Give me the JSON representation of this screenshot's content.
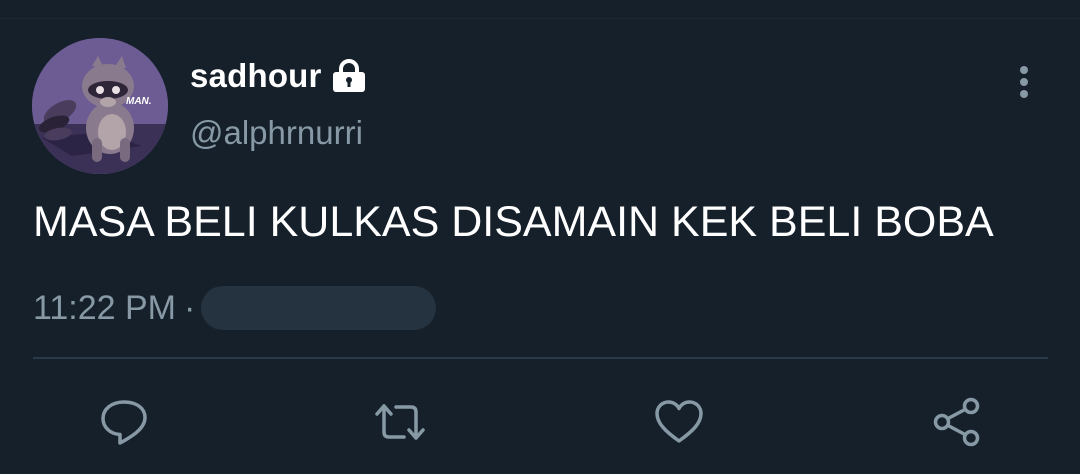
{
  "tweet": {
    "display_name": "sadhour",
    "handle": "@alphrnurri",
    "text": "MASA BELI KULKAS DISAMAIN KEK BELI BOBA",
    "time": "11:22 PM",
    "separator": "·",
    "avatar_caption": "MAN."
  },
  "icons": {
    "lock": "lock-icon",
    "more": "more-vertical-icon",
    "reply": "reply-bubble-icon",
    "retweet": "retweet-icon",
    "like": "heart-icon",
    "share": "share-icon"
  },
  "colors": {
    "background": "#15202b",
    "secondary_text": "#8899a6",
    "divider": "#2b3a48",
    "redacted": "#253341"
  }
}
